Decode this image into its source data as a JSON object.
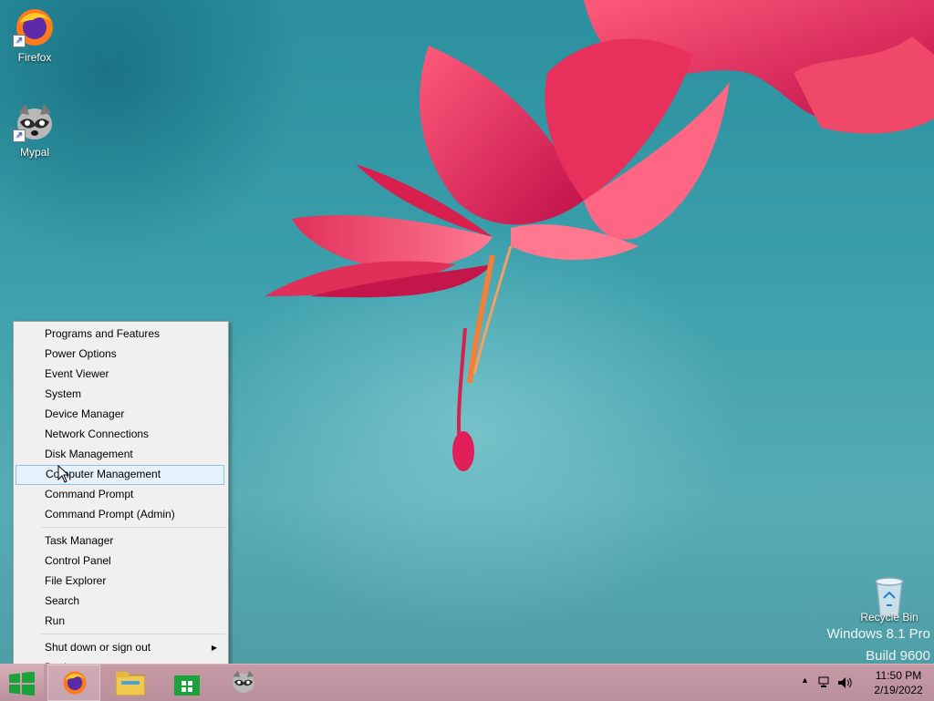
{
  "desktop": {
    "icons": [
      {
        "label": "Firefox"
      },
      {
        "label": "Mypal"
      },
      {
        "label": "Recycle Bin"
      }
    ],
    "watermark": {
      "line1": "Windows 8.1 Pro",
      "line2": "Build 9600"
    }
  },
  "context_menu": {
    "items": [
      {
        "label": "Programs and Features"
      },
      {
        "label": "Power Options"
      },
      {
        "label": "Event Viewer"
      },
      {
        "label": "System"
      },
      {
        "label": "Device Manager"
      },
      {
        "label": "Network Connections"
      },
      {
        "label": "Disk Management"
      },
      {
        "label": "Computer Management",
        "highlighted": true
      },
      {
        "label": "Command Prompt"
      },
      {
        "label": "Command Prompt (Admin)"
      },
      {
        "label": "Task Manager"
      },
      {
        "label": "Control Panel"
      },
      {
        "label": "File Explorer"
      },
      {
        "label": "Search"
      },
      {
        "label": "Run"
      },
      {
        "label": "Shut down or sign out",
        "submenu": true
      },
      {
        "label": "Desktop"
      }
    ]
  },
  "taskbar": {
    "pinned": [
      {
        "icon": "firefox-icon"
      },
      {
        "icon": "file-explorer-icon"
      },
      {
        "icon": "store-icon"
      },
      {
        "icon": "mypal-icon"
      }
    ],
    "tray": {
      "icons": [
        "show-hidden-icons",
        "network-icon",
        "volume-icon"
      ],
      "time": "11:50 PM",
      "date": "2/19/2022"
    }
  }
}
